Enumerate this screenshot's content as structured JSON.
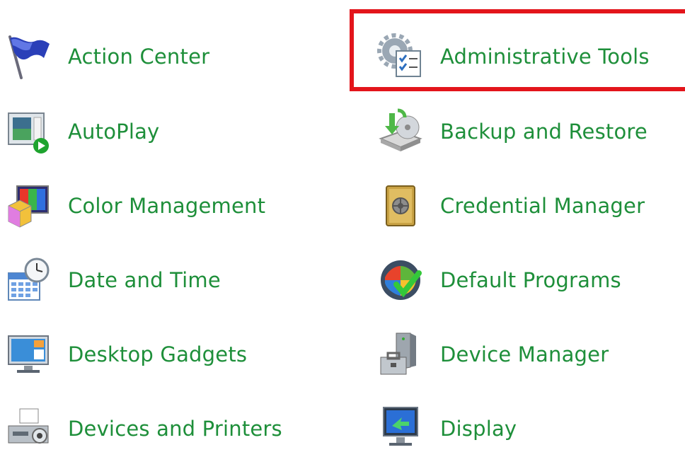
{
  "items": [
    {
      "label": "Action Center",
      "icon": "flag-icon"
    },
    {
      "label": "Administrative Tools",
      "icon": "admin-tools-icon"
    },
    {
      "label": "AutoPlay",
      "icon": "autoplay-icon"
    },
    {
      "label": "Backup and Restore",
      "icon": "backup-icon"
    },
    {
      "label": "Color Management",
      "icon": "color-management-icon"
    },
    {
      "label": "Credential Manager",
      "icon": "vault-icon"
    },
    {
      "label": "Date and Time",
      "icon": "calendar-clock-icon"
    },
    {
      "label": "Default Programs",
      "icon": "windows-check-icon"
    },
    {
      "label": "Desktop Gadgets",
      "icon": "gadgets-icon"
    },
    {
      "label": "Device Manager",
      "icon": "device-manager-icon"
    },
    {
      "label": "Devices and Printers",
      "icon": "printer-icon"
    },
    {
      "label": "Display",
      "icon": "monitor-icon"
    }
  ],
  "colors": {
    "link_text": "#1e8f3a",
    "highlight": "#e3151b",
    "background": "#ffffff"
  },
  "highlighted_item": "Administrative Tools"
}
